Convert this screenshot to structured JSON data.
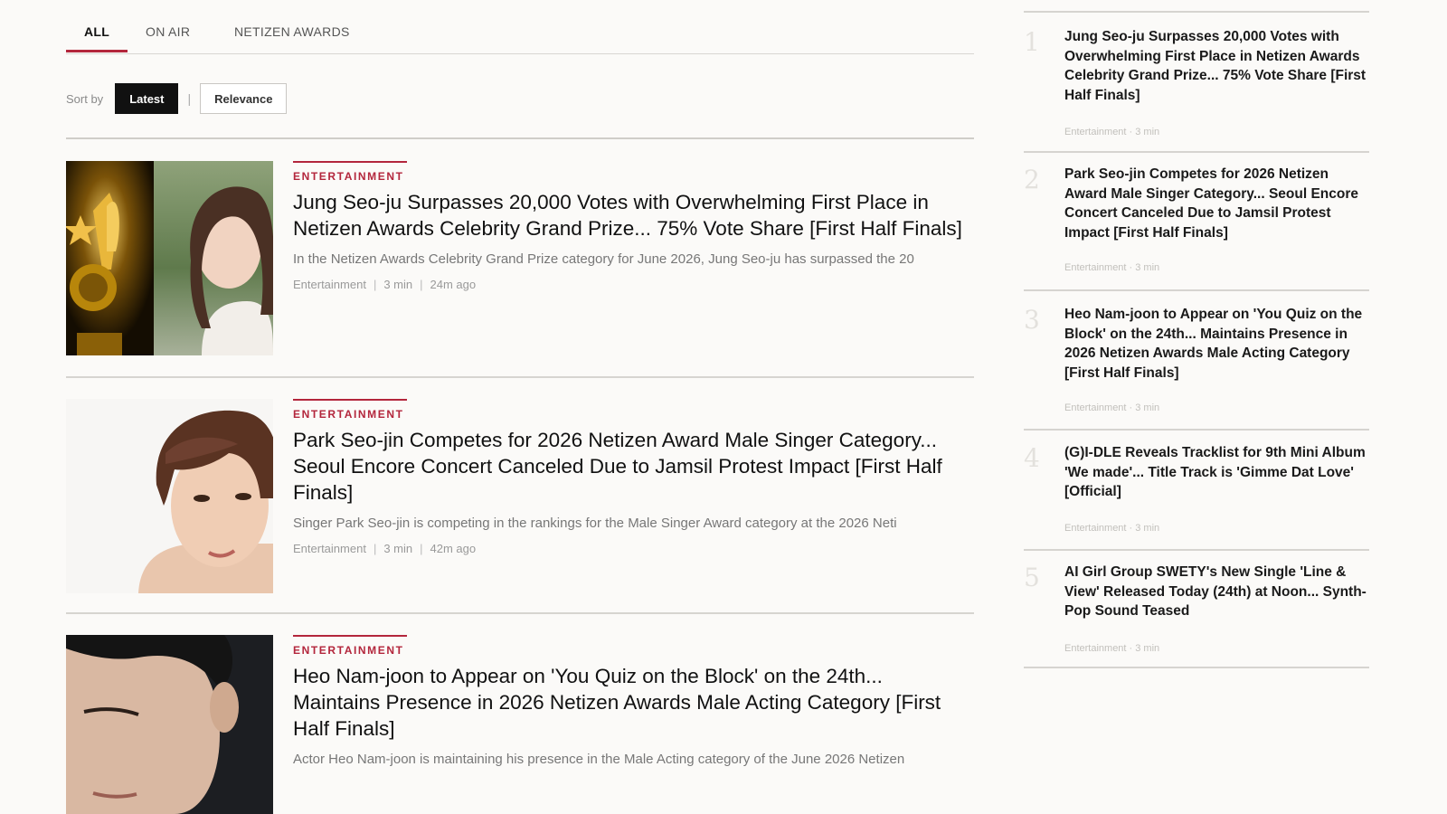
{
  "tabs": [
    {
      "label": "ALL"
    },
    {
      "label": "ON AIR"
    },
    {
      "label": "NETIZEN AWARDS"
    }
  ],
  "sort": {
    "label": "Sort by",
    "options": [
      {
        "label": "Latest",
        "active": true
      },
      {
        "label": "Relevance",
        "active": false
      }
    ],
    "separator": "|"
  },
  "articles": [
    {
      "category": "ENTERTAINMENT",
      "title": "Jung Seo-ju Surpasses 20,000 Votes with Overwhelming First Place in Netizen Awards Celebrity Grand Prize... 75% Vote Share [First Half Finals]",
      "excerpt": "In the Netizen Awards Celebrity Grand Prize category for June 2026, Jung Seo-ju has surpassed the 20",
      "section": "Entertainment",
      "read_time": "3 min",
      "time_ago": "24m ago"
    },
    {
      "category": "ENTERTAINMENT",
      "title": "Park Seo-jin Competes for 2026 Netizen Award Male Singer Category... Seoul Encore Concert Canceled Due to Jamsil Protest Impact [First Half Finals]",
      "excerpt": "Singer Park Seo-jin is competing in the rankings for the Male Singer Award category at the 2026 Neti",
      "section": "Entertainment",
      "read_time": "3 min",
      "time_ago": "42m ago"
    },
    {
      "category": "ENTERTAINMENT",
      "title": "Heo Nam-joon to Appear on 'You Quiz on the Block' on the 24th... Maintains Presence in 2026 Netizen Awards Male Acting Category [First Half Finals]",
      "excerpt": "Actor Heo Nam-joon is maintaining his presence in the Male Acting category of the June 2026 Netizen"
    }
  ],
  "meta_separator": "|",
  "sidebar": {
    "items": [
      {
        "rank": "1",
        "title": "Jung Seo-ju Surpasses 20,000 Votes with Overwhelming First Place in Netizen Awards Celebrity Grand Prize... 75% Vote Share [First Half Finals]",
        "meta": "Entertainment · 3 min"
      },
      {
        "rank": "2",
        "title": "Park Seo-jin Competes for 2026 Netizen Award Male Singer Category... Seoul Encore Concert Canceled Due to Jamsil Protest Impact [First Half Finals]",
        "meta": "Entertainment · 3 min"
      },
      {
        "rank": "3",
        "title": "Heo Nam-joon to Appear on 'You Quiz on the Block' on the 24th... Maintains Presence in 2026 Netizen Awards Male Acting Category [First Half Finals]",
        "meta": "Entertainment · 3 min"
      },
      {
        "rank": "4",
        "title": "(G)I-DLE Reveals Tracklist for 9th Mini Album 'We made'... Title Track is 'Gimme Dat Love' [Official]",
        "meta": "Entertainment · 3 min"
      },
      {
        "rank": "5",
        "title": "AI Girl Group SWETY's New Single 'Line & View' Released Today (24th) at Noon... Synth-Pop Sound Teased",
        "meta": "Entertainment · 3 min"
      }
    ]
  },
  "colors": {
    "accent": "#b3263c",
    "background": "#fbfaf8",
    "active_sort_bg": "#111111"
  }
}
